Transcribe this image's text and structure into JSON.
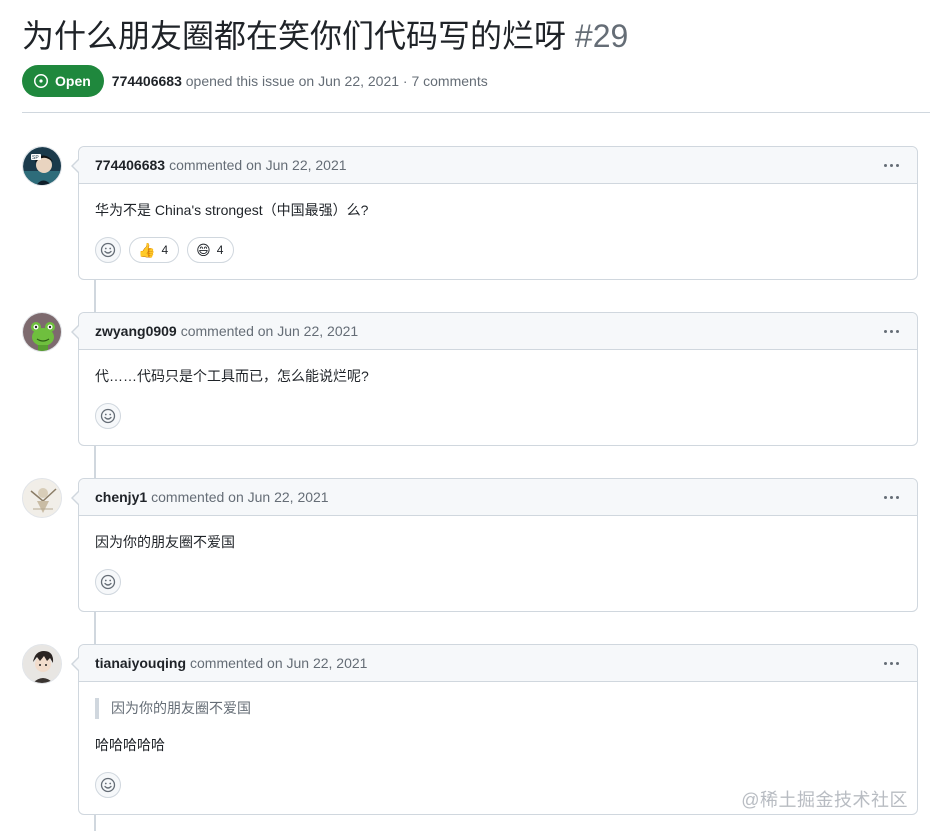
{
  "issue": {
    "title": "为什么朋友圈都在笑你们代码写的烂呀",
    "number": "#29",
    "state": "Open",
    "author": "774406683",
    "opened_text": "opened this issue on Jun 22, 2021 · 7 comments"
  },
  "comments": [
    {
      "author": "774406683",
      "meta": "commented on Jun 22, 2021",
      "body": "华为不是 China's strongest（中国最强）么?",
      "reactions": [
        {
          "emoji": "👍",
          "count": "4"
        },
        {
          "emoji": "😄",
          "count": "4"
        }
      ]
    },
    {
      "author": "zwyang0909",
      "meta": "commented on Jun 22, 2021",
      "body": "代……代码只是个工具而已，怎么能说烂呢?"
    },
    {
      "author": "chenjy1",
      "meta": "commented on Jun 22, 2021",
      "body": "因为你的朋友圈不爱国"
    },
    {
      "author": "tianaiyouqing",
      "meta": "commented on Jun 22, 2021",
      "quote": "因为你的朋友圈不爱国",
      "body": "哈哈哈哈哈"
    }
  ],
  "watermark": "@稀土掘金技术社区",
  "colors": {
    "open_green": "#1f883d",
    "border": "#d0d7de",
    "header_bg": "#f6f8fa",
    "muted_text": "#656d76"
  }
}
